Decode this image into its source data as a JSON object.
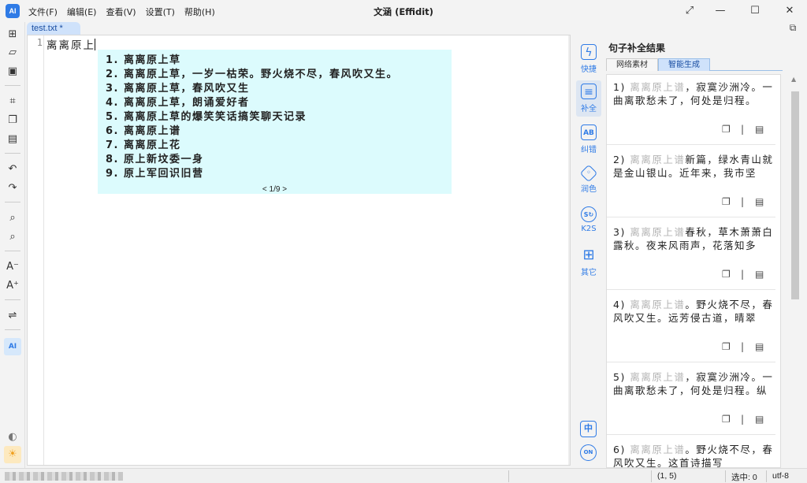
{
  "app": {
    "title": "文涵 (Effidit)",
    "menu": [
      "文件(F)",
      "编辑(E)",
      "查看(V)",
      "设置(T)",
      "帮助(H)"
    ],
    "icon_text": "AI"
  },
  "editor": {
    "tab_label": "test.txt *",
    "line_number": "1",
    "line_text": "离离原上"
  },
  "suggestions": {
    "items": [
      "1. 离离原上草",
      "2. 离离原上草，一岁一枯荣。野火烧不尽，春风吹又生。",
      "3. 离离原上草，春风吹又生",
      "4. 离离原上草，朗诵爱好者",
      "5. 离离原上草的爆笑笑话搞笑聊天记录",
      "6. 离离原上谱",
      "7. 离离原上花",
      "8. 原上新坟委一身",
      "9. 原上军回识旧营"
    ],
    "pager": "< 1/9 >"
  },
  "right_toolbar": {
    "items": [
      {
        "label": "快捷",
        "icon": "lightning-icon"
      },
      {
        "label": "补全",
        "icon": "completion-icon"
      },
      {
        "label": "纠错",
        "icon": "proofread-icon"
      },
      {
        "label": "润色",
        "icon": "polish-icon"
      },
      {
        "label": "K2S",
        "icon": "k2s-icon"
      },
      {
        "label": "其它",
        "icon": "grid-icon"
      }
    ],
    "lang_label": "中",
    "toggle_label": "ON"
  },
  "panel": {
    "title": "句子补全结果",
    "tabs": [
      "网络素材",
      "智能生成"
    ],
    "active_tab": 1,
    "results": [
      {
        "num": "1)",
        "prefix": "离离原上谱",
        "text": "，寂寞沙洲冷。一曲离歌愁未了，何处是归程。"
      },
      {
        "num": "2)",
        "prefix": "离离原上谱",
        "text": "新篇，绿水青山就是金山银山。近年来，我市坚"
      },
      {
        "num": "3)",
        "prefix": "离离原上谱",
        "text": "春秋，草木萧萧白露秋。夜来风雨声，花落知多"
      },
      {
        "num": "4)",
        "prefix": "离离原上谱",
        "text": "。野火烧不尽，春风吹又生。远芳侵古道，晴翠"
      },
      {
        "num": "5)",
        "prefix": "离离原上谱",
        "text": "，寂寞沙洲冷。一曲离歌愁未了，何处是归程。纵"
      },
      {
        "num": "6)",
        "prefix": "离离原上谱",
        "text": "。野火烧不尽，春风吹又生。这首诗描写"
      }
    ]
  },
  "status": {
    "position": "(1, 5)",
    "selection": "选中: 0",
    "encoding": "utf-8"
  },
  "colors": {
    "accent": "#2f7be6",
    "popup_bg": "#dcfbfd",
    "tab_bg": "#cfe2fb",
    "prefix_gray": "#b4b4b4"
  }
}
